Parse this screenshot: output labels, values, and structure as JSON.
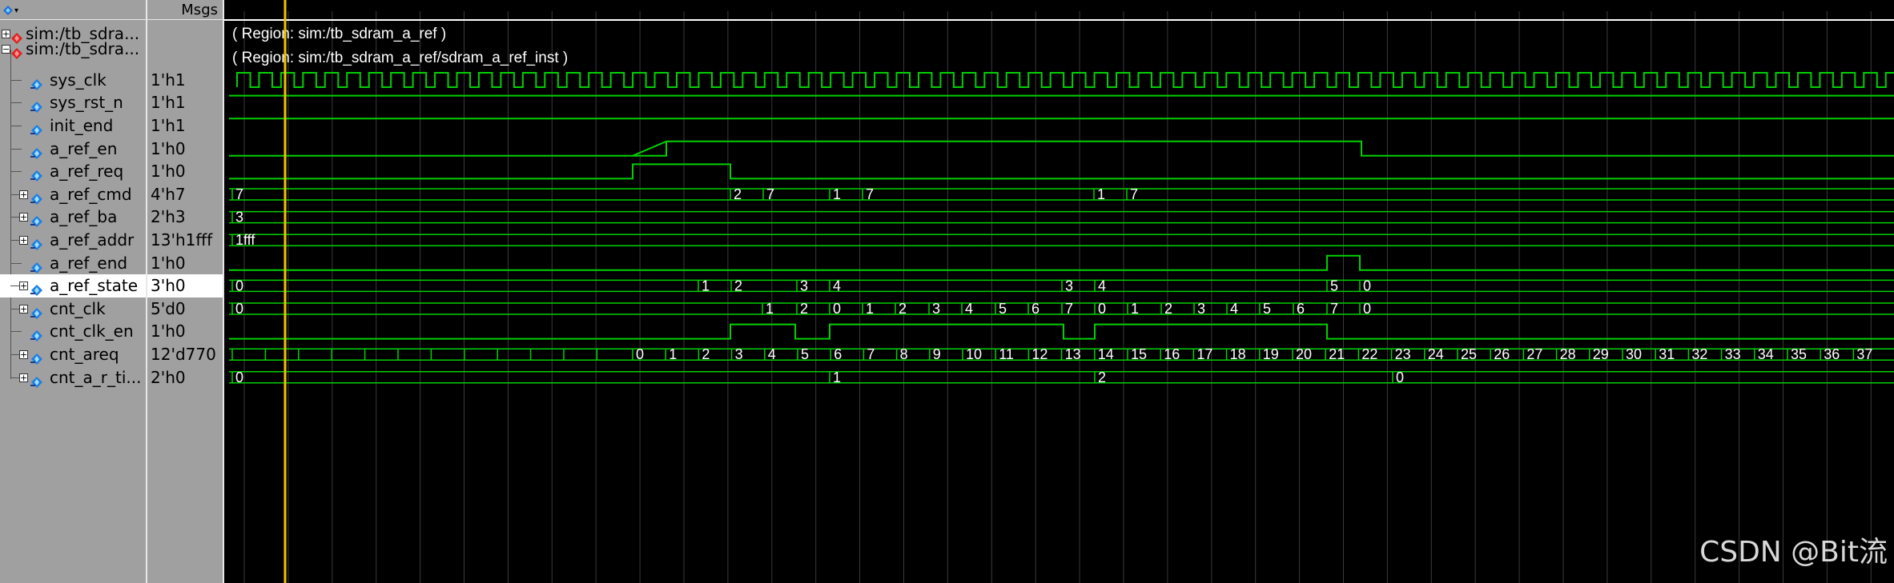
{
  "header": {
    "msgs_label": "Msgs"
  },
  "colors": {
    "wave": "#00d000",
    "cursor": "#f2c200",
    "grid": "#3a3a3a",
    "text": "#ffffff",
    "panel": "#a0a0a0"
  },
  "groups": [
    {
      "name": "sim:/tb_sdra...",
      "region": "( Region: sim:/tb_sdram_a_ref )",
      "icon": "red-diamond-icon"
    },
    {
      "name": "sim:/tb_sdra...",
      "region": "( Region: sim:/tb_sdram_a_ref/sdram_a_ref_inst )",
      "icon": "red-diamond-icon"
    }
  ],
  "signals": [
    {
      "name": "sys_clk",
      "value": "1'h1"
    },
    {
      "name": "sys_rst_n",
      "value": "1'h1"
    },
    {
      "name": "init_end",
      "value": "1'h1"
    },
    {
      "name": "a_ref_en",
      "value": "1'h0"
    },
    {
      "name": "a_ref_req",
      "value": "1'h0"
    },
    {
      "name": "a_ref_cmd",
      "value": "4'h7",
      "bus": true,
      "labels": [
        "7",
        "2",
        "7",
        "1",
        "7",
        "1",
        "7"
      ]
    },
    {
      "name": "a_ref_ba",
      "value": "2'h3",
      "bus": true,
      "labels": [
        "3"
      ]
    },
    {
      "name": "a_ref_addr",
      "value": "13'h1fff",
      "bus": true,
      "labels": [
        "1fff"
      ]
    },
    {
      "name": "a_ref_end",
      "value": "1'h0"
    },
    {
      "name": "a_ref_state",
      "value": "3'h0",
      "bus": true,
      "selected": true,
      "labels": [
        "0",
        "1",
        "2",
        "3",
        "4",
        "3",
        "4",
        "5",
        "0"
      ]
    },
    {
      "name": "cnt_clk",
      "value": "5'd0",
      "bus": true,
      "labels": [
        "0",
        "1",
        "2",
        "0",
        "1",
        "2",
        "3",
        "4",
        "5",
        "6",
        "7",
        "0",
        "1",
        "2",
        "3",
        "4",
        "5",
        "6",
        "7",
        "0"
      ]
    },
    {
      "name": "cnt_clk_en",
      "value": "1'h0"
    },
    {
      "name": "cnt_areq",
      "value": "12'd770",
      "bus": true,
      "labels": [
        "0",
        "1",
        "2",
        "3",
        "4",
        "5",
        "6",
        "7",
        "8",
        "9",
        "10",
        "11",
        "12",
        "13",
        "14",
        "15",
        "16",
        "17",
        "18",
        "19",
        "20",
        "21",
        "22",
        "23",
        "24",
        "25",
        "26",
        "27",
        "28",
        "29",
        "30",
        "31",
        "32",
        "33",
        "34",
        "35",
        "36",
        "37"
      ]
    },
    {
      "name": "cnt_a_r_ti...",
      "value": "2'h0",
      "bus": true,
      "labels": [
        "0",
        "1",
        "2",
        "0"
      ]
    }
  ],
  "watermark": "CSDN @Bit流"
}
